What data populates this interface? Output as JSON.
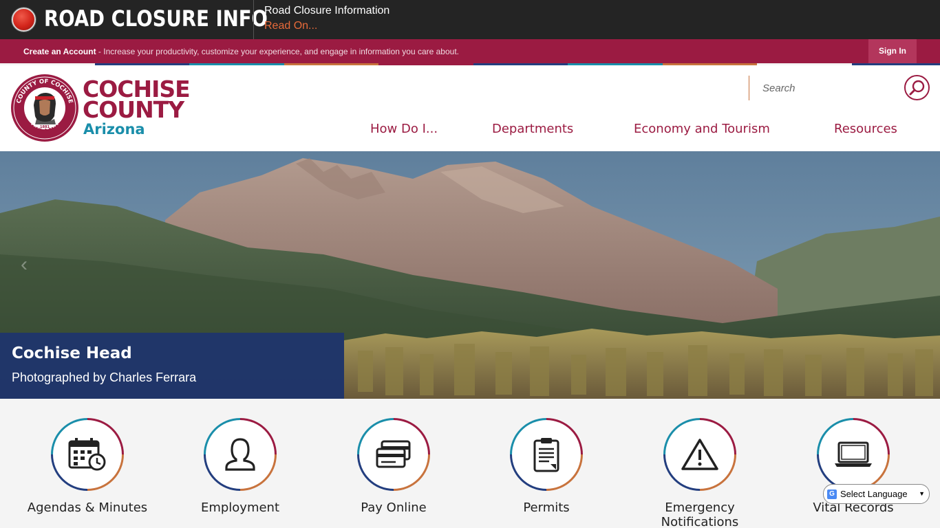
{
  "alert": {
    "badge_title": "ROAD CLOSURE INFO",
    "heading": "Road Closure Information",
    "link_text": "Read On..."
  },
  "account": {
    "create_link": "Create an Account",
    "description": " - Increase your productivity, customize your experience, and engage in information you care about.",
    "sign_in": "Sign In"
  },
  "logo": {
    "line1": "COCHISE",
    "line2": "COUNTY",
    "line3": "Arizona",
    "seal_top": "COUNTY OF COCHISE",
    "seal_bottom": "ARIZONA",
    "seal_year": "1881"
  },
  "search": {
    "placeholder": "Search"
  },
  "nav": {
    "items": [
      {
        "label": "How Do I..."
      },
      {
        "label": "Departments"
      },
      {
        "label": "Economy and Tourism"
      },
      {
        "label": "Resources"
      }
    ]
  },
  "hero": {
    "title": "Cochise Head",
    "subtitle": "Photographed by Charles Ferrara",
    "prev_glyph": "‹"
  },
  "quick_links": [
    {
      "label": "Agendas & Minutes",
      "icon": "calendar-clock-icon"
    },
    {
      "label": "Employment",
      "icon": "person-icon"
    },
    {
      "label": "Pay Online",
      "icon": "credit-card-icon"
    },
    {
      "label": "Permits",
      "icon": "clipboard-icon"
    },
    {
      "label": "Emergency Notifications",
      "icon": "warning-icon"
    },
    {
      "label": "Vital Records",
      "icon": "laptop-icon"
    }
  ],
  "translate": {
    "label": "Select Language"
  },
  "colors": {
    "brand": "#9b1b42",
    "accent_teal": "#1a8eaa",
    "accent_orange": "#c8733d",
    "accent_navy": "#233e7f",
    "alert_bg": "#242424",
    "link_orange": "#e86a3a"
  }
}
